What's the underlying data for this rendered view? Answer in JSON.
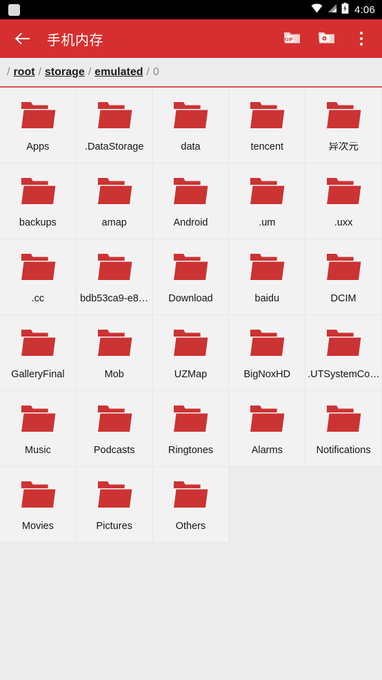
{
  "status_bar": {
    "notification_icon": "app-notification-icon",
    "wifi_icon": "wifi-icon",
    "signal_icon": "cell-signal-icon",
    "battery_icon": "battery-charging-icon",
    "time": "4:06"
  },
  "app_bar": {
    "back_icon": "back-arrow-icon",
    "title": "手机内存",
    "actions": [
      {
        "name": "gif-folder-button",
        "icon": "gif-folder-icon",
        "label": "GIF"
      },
      {
        "name": "camera-folder-button",
        "icon": "camera-folder-icon",
        "label": ""
      },
      {
        "name": "overflow-menu-button",
        "icon": "more-vertical-icon",
        "label": ""
      }
    ]
  },
  "breadcrumb": {
    "leading_separator": "/",
    "separator": "/",
    "segments": [
      {
        "label": "root",
        "current": false
      },
      {
        "label": "storage",
        "current": false
      },
      {
        "label": "emulated",
        "current": false
      },
      {
        "label": "0",
        "current": true
      }
    ]
  },
  "colors": {
    "app_bar_red": "#d5302f",
    "folder_red": "#cc3333",
    "page_background": "#ececec",
    "cell_background": "#f2f2f2",
    "divider": "#e7e7e7",
    "status_bar": "#000000",
    "crumb_rule": "#d9534f"
  },
  "file_grid": {
    "columns": 5,
    "items": [
      {
        "name": "Apps",
        "type": "folder"
      },
      {
        "name": ".DataStorage",
        "type": "folder"
      },
      {
        "name": "data",
        "type": "folder"
      },
      {
        "name": "tencent",
        "type": "folder"
      },
      {
        "name": "异次元",
        "type": "folder"
      },
      {
        "name": "backups",
        "type": "folder"
      },
      {
        "name": "amap",
        "type": "folder"
      },
      {
        "name": "Android",
        "type": "folder"
      },
      {
        "name": ".um",
        "type": "folder"
      },
      {
        "name": ".uxx",
        "type": "folder"
      },
      {
        "name": ".cc",
        "type": "folder"
      },
      {
        "name": "bdb53ca9-e8…",
        "type": "folder"
      },
      {
        "name": "Download",
        "type": "folder"
      },
      {
        "name": "baidu",
        "type": "folder"
      },
      {
        "name": "DCIM",
        "type": "folder"
      },
      {
        "name": "GalleryFinal",
        "type": "folder"
      },
      {
        "name": "Mob",
        "type": "folder"
      },
      {
        "name": "UZMap",
        "type": "folder"
      },
      {
        "name": "BigNoxHD",
        "type": "folder"
      },
      {
        "name": ".UTSystemCo…",
        "type": "folder"
      },
      {
        "name": "Music",
        "type": "folder"
      },
      {
        "name": "Podcasts",
        "type": "folder"
      },
      {
        "name": "Ringtones",
        "type": "folder"
      },
      {
        "name": "Alarms",
        "type": "folder"
      },
      {
        "name": "Notifications",
        "type": "folder"
      },
      {
        "name": "Movies",
        "type": "folder"
      },
      {
        "name": "Pictures",
        "type": "folder"
      },
      {
        "name": "Others",
        "type": "folder"
      }
    ]
  }
}
